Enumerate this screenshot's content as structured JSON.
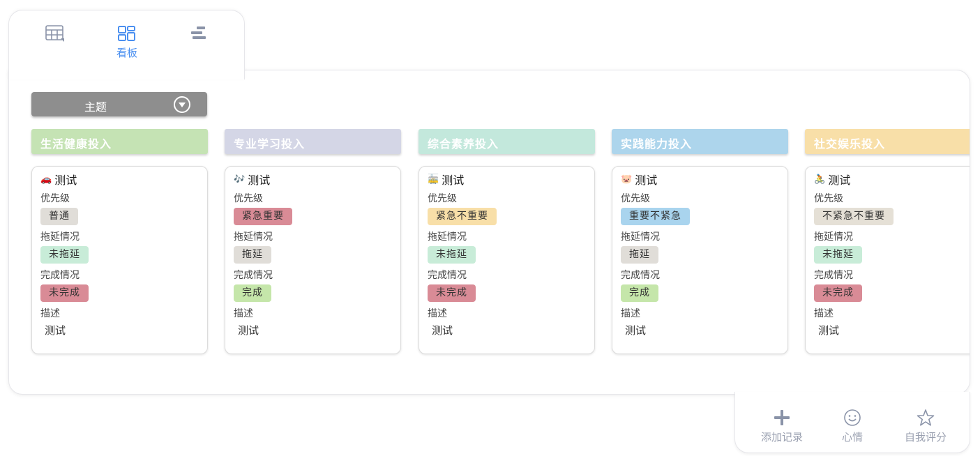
{
  "view_tabs": {
    "table_icon": "table-icon",
    "kanban_icon": "kanban-icon",
    "kanban_label": "看板",
    "gantt_icon": "gantt-icon"
  },
  "group_select": {
    "label": "主题"
  },
  "columns": [
    {
      "header": "生活健康投入",
      "color": "#c5e3b4",
      "card": {
        "emoji": "🚗",
        "title": "测试",
        "priority_label": "优先级",
        "priority": "普通",
        "priority_color": "#e0ddd8",
        "delay_label": "拖延情况",
        "delay": "未拖延",
        "delay_color": "#c8ecd8",
        "complete_label": "完成情况",
        "complete": "未完成",
        "complete_color": "#d98b96",
        "desc_label": "描述",
        "desc": "测试"
      }
    },
    {
      "header": "专业学习投入",
      "color": "#d4d6e6",
      "card": {
        "emoji": "🎶",
        "title": "测试",
        "priority_label": "优先级",
        "priority": "紧急重要",
        "priority_color": "#d98b96",
        "delay_label": "拖延情况",
        "delay": "拖延",
        "delay_color": "#e0ddd8",
        "complete_label": "完成情况",
        "complete": "完成",
        "complete_color": "#c5e6aa",
        "desc_label": "描述",
        "desc": "测试"
      }
    },
    {
      "header": "综合素养投入",
      "color": "#c3e8dc",
      "card": {
        "emoji": "🚋",
        "title": "测试",
        "priority_label": "优先级",
        "priority": "紧急不重要",
        "priority_color": "#f8dfa8",
        "delay_label": "拖延情况",
        "delay": "未拖延",
        "delay_color": "#c8ecd8",
        "complete_label": "完成情况",
        "complete": "未完成",
        "complete_color": "#d98b96",
        "desc_label": "描述",
        "desc": "测试"
      }
    },
    {
      "header": "实践能力投入",
      "color": "#add5ec",
      "card": {
        "emoji": "🐷",
        "title": "测试",
        "priority_label": "优先级",
        "priority": "重要不紧急",
        "priority_color": "#a9d4ee",
        "delay_label": "拖延情况",
        "delay": "拖延",
        "delay_color": "#e0ddd8",
        "complete_label": "完成情况",
        "complete": "完成",
        "complete_color": "#c5e6aa",
        "desc_label": "描述",
        "desc": "测试"
      }
    },
    {
      "header": "社交娱乐投入",
      "color": "#f8dfa8",
      "card": {
        "emoji": "🚴",
        "title": "测试",
        "priority_label": "优先级",
        "priority": "不紧急不重要",
        "priority_color": "#e5e0d6",
        "delay_label": "拖延情况",
        "delay": "未拖延",
        "delay_color": "#c8ecd8",
        "complete_label": "完成情况",
        "complete": "未完成",
        "complete_color": "#d98b96",
        "desc_label": "描述",
        "desc": "测试"
      }
    }
  ],
  "toolbar": {
    "add_icon": "plus-icon",
    "add_label": "添加记录",
    "mood_icon": "smile-icon",
    "mood_label": "心情",
    "rate_icon": "star-icon",
    "rate_label": "自我评分"
  }
}
